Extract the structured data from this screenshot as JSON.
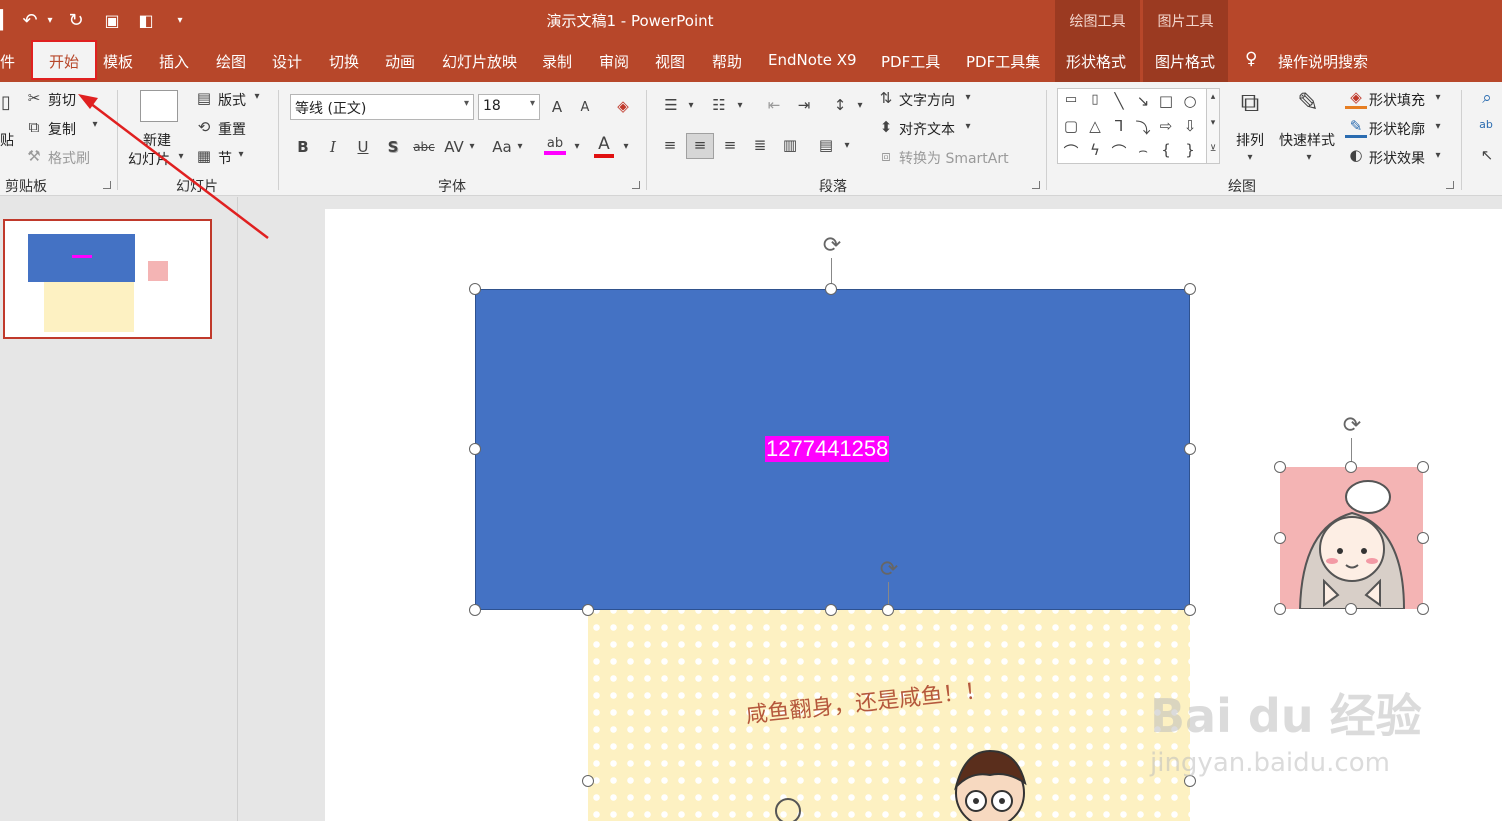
{
  "titlebar": {
    "title": "演示文稿1  -  PowerPoint",
    "ctx_drawing_tools": "绘图工具",
    "ctx_picture_tools": "图片工具",
    "accent": "#b7472a"
  },
  "quick_access": [
    "undo-icon",
    "redo-icon",
    "slideshow-icon",
    "layout-icon",
    "customize-icon"
  ],
  "tabs": {
    "file_partial": "件",
    "home": "开始",
    "template": "模板",
    "insert": "插入",
    "draw": "绘图",
    "design": "设计",
    "transition": "切换",
    "animation": "动画",
    "slideshow": "幻灯片放映",
    "record": "录制",
    "review": "审阅",
    "view": "视图",
    "help": "帮助",
    "endnote": "EndNote X9",
    "pdf_tools": "PDF工具",
    "pdf_toolset": "PDF工具集",
    "shape_format": "形状格式",
    "picture_format": "图片格式",
    "tell_me": "操作说明搜索"
  },
  "ribbon": {
    "clipboard": {
      "paste_partial": "贴",
      "cut": "剪切",
      "copy": "复制",
      "format_painter": "格式刷",
      "group_label": "剪贴板"
    },
    "slides": {
      "new_slide_line1": "新建",
      "new_slide_line2": "幻灯片",
      "layout": "版式",
      "reset": "重置",
      "section": "节",
      "group_label": "幻灯片"
    },
    "font": {
      "font_name": "等线 (正文)",
      "font_size": "18",
      "bold": "B",
      "italic": "I",
      "underline": "U",
      "shadow": "S",
      "strike": "abc",
      "spacing": "AV",
      "change_case": "Aa",
      "highlight": "ab",
      "font_color": "A",
      "grow": "A",
      "shrink": "A",
      "group_label": "字体"
    },
    "paragraph": {
      "text_direction": "文字方向",
      "align_text": "对齐文本",
      "smartart": "转换为 SmartArt",
      "group_label": "段落"
    },
    "drawing": {
      "arrange": "排列",
      "quick_styles": "快速样式",
      "shape_fill": "形状填充",
      "shape_outline": "形状轮廓",
      "shape_effect": "形状效果",
      "group_label": "绘图"
    }
  },
  "slide": {
    "rect_text": "1277441258",
    "rect_color": "#4472c4",
    "rect_text_bg": "#ff00ff",
    "yellow_caption": "咸鱼翻身，还是咸鱼！！"
  },
  "watermark": {
    "brand": "Bai du 经验",
    "url": "jingyan.baidu.com"
  }
}
